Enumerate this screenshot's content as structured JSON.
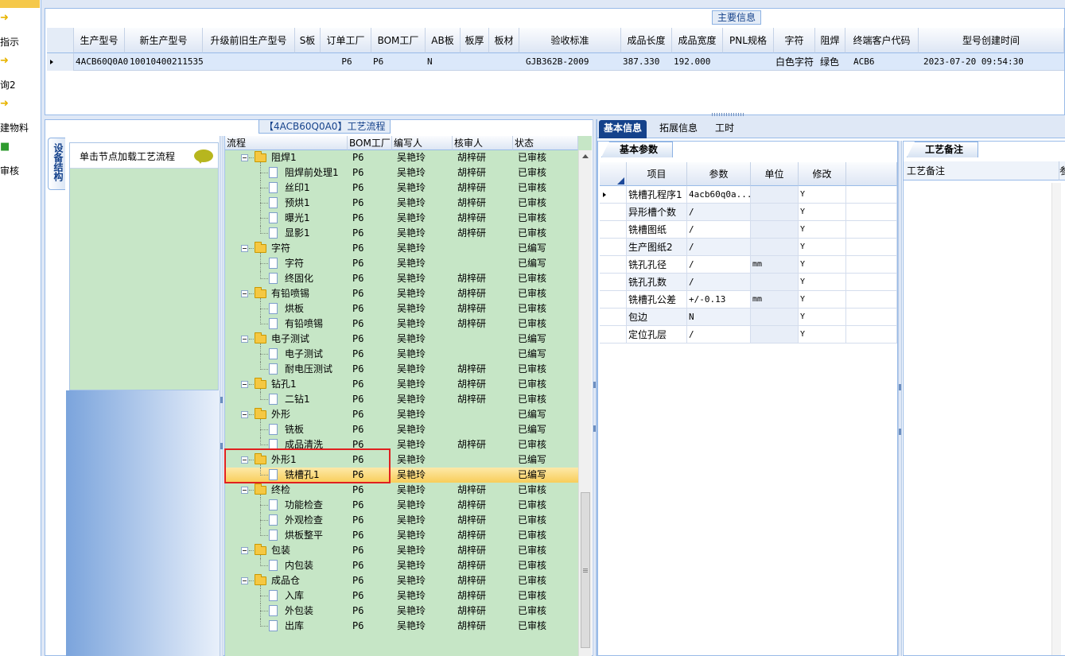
{
  "leftnav": {
    "items": [
      {
        "label": "指示",
        "icon": "folder-arrow-icon"
      },
      {
        "label": "询2",
        "icon": "folder-arrow-icon"
      },
      {
        "label": "建物料",
        "icon": "folder-arrow-icon"
      },
      {
        "label": "审核",
        "icon": "green-doc-icon"
      }
    ]
  },
  "main_info": {
    "title": "主要信息",
    "columns": [
      "生产型号",
      "新生产型号",
      "升级前旧生产型号",
      "S板",
      "订单工厂",
      "BOM工厂",
      "AB板",
      "板厚",
      "板材",
      "验收标准",
      "成品长度",
      "成品宽度",
      "PNL规格",
      "字符",
      "阻焊",
      "终端客户代码",
      "型号创建时间"
    ],
    "row": [
      "4ACB60Q0A0",
      "10010400211535",
      "",
      "",
      "P6",
      "P6",
      "N",
      "",
      "",
      "GJB362B-2009",
      "387.330",
      "192.000",
      "",
      "白色字符",
      "绿色",
      "ACB6",
      "2023-07-20 09:54:30"
    ]
  },
  "process": {
    "title": "【4ACB60Q0A0】工艺流程",
    "side_tab": "设备结构",
    "hint": "单击节点加载工艺流程",
    "columns": [
      "流程",
      "BOM工厂",
      "编写人",
      "核审人",
      "状态"
    ],
    "rows": [
      {
        "name": "阻焊1",
        "level": 0,
        "bom": "P6",
        "writer": "吴艳玲",
        "reviewer": "胡梓研",
        "status": "已审核"
      },
      {
        "name": "阻焊前处理1",
        "level": 1,
        "bom": "P6",
        "writer": "吴艳玲",
        "reviewer": "胡梓研",
        "status": "已审核"
      },
      {
        "name": "丝印1",
        "level": 1,
        "bom": "P6",
        "writer": "吴艳玲",
        "reviewer": "胡梓研",
        "status": "已审核"
      },
      {
        "name": "预烘1",
        "level": 1,
        "bom": "P6",
        "writer": "吴艳玲",
        "reviewer": "胡梓研",
        "status": "已审核"
      },
      {
        "name": "曝光1",
        "level": 1,
        "bom": "P6",
        "writer": "吴艳玲",
        "reviewer": "胡梓研",
        "status": "已审核"
      },
      {
        "name": "显影1",
        "level": 1,
        "bom": "P6",
        "writer": "吴艳玲",
        "reviewer": "胡梓研",
        "status": "已审核"
      },
      {
        "name": "字符",
        "level": 0,
        "bom": "P6",
        "writer": "吴艳玲",
        "reviewer": "",
        "status": "已编写"
      },
      {
        "name": "字符",
        "level": 1,
        "bom": "P6",
        "writer": "吴艳玲",
        "reviewer": "",
        "status": "已编写"
      },
      {
        "name": "终固化",
        "level": 1,
        "bom": "P6",
        "writer": "吴艳玲",
        "reviewer": "胡梓研",
        "status": "已审核"
      },
      {
        "name": "有铅喷锡",
        "level": 0,
        "bom": "P6",
        "writer": "吴艳玲",
        "reviewer": "胡梓研",
        "status": "已审核"
      },
      {
        "name": "烘板",
        "level": 1,
        "bom": "P6",
        "writer": "吴艳玲",
        "reviewer": "胡梓研",
        "status": "已审核"
      },
      {
        "name": "有铅喷锡",
        "level": 1,
        "bom": "P6",
        "writer": "吴艳玲",
        "reviewer": "胡梓研",
        "status": "已审核"
      },
      {
        "name": "电子测试",
        "level": 0,
        "bom": "P6",
        "writer": "吴艳玲",
        "reviewer": "",
        "status": "已编写"
      },
      {
        "name": "电子测试",
        "level": 1,
        "bom": "P6",
        "writer": "吴艳玲",
        "reviewer": "",
        "status": "已编写"
      },
      {
        "name": "耐电压测试",
        "level": 1,
        "bom": "P6",
        "writer": "吴艳玲",
        "reviewer": "胡梓研",
        "status": "已审核"
      },
      {
        "name": "钻孔1",
        "level": 0,
        "bom": "P6",
        "writer": "吴艳玲",
        "reviewer": "胡梓研",
        "status": "已审核"
      },
      {
        "name": "二钻1",
        "level": 1,
        "bom": "P6",
        "writer": "吴艳玲",
        "reviewer": "胡梓研",
        "status": "已审核"
      },
      {
        "name": "外形",
        "level": 0,
        "bom": "P6",
        "writer": "吴艳玲",
        "reviewer": "",
        "status": "已编写"
      },
      {
        "name": "铣板",
        "level": 1,
        "bom": "P6",
        "writer": "吴艳玲",
        "reviewer": "",
        "status": "已编写"
      },
      {
        "name": "成品清洗",
        "level": 1,
        "bom": "P6",
        "writer": "吴艳玲",
        "reviewer": "胡梓研",
        "status": "已审核"
      },
      {
        "name": "外形1",
        "level": 0,
        "bom": "P6",
        "writer": "吴艳玲",
        "reviewer": "",
        "status": "已编写"
      },
      {
        "name": "铣槽孔1",
        "level": 1,
        "bom": "P6",
        "writer": "吴艳玲",
        "reviewer": "",
        "status": "已编写",
        "selected": true
      },
      {
        "name": "终检",
        "level": 0,
        "bom": "P6",
        "writer": "吴艳玲",
        "reviewer": "胡梓研",
        "status": "已审核"
      },
      {
        "name": "功能检查",
        "level": 1,
        "bom": "P6",
        "writer": "吴艳玲",
        "reviewer": "胡梓研",
        "status": "已审核"
      },
      {
        "name": "外观检查",
        "level": 1,
        "bom": "P6",
        "writer": "吴艳玲",
        "reviewer": "胡梓研",
        "status": "已审核"
      },
      {
        "name": "烘板整平",
        "level": 1,
        "bom": "P6",
        "writer": "吴艳玲",
        "reviewer": "胡梓研",
        "status": "已审核"
      },
      {
        "name": "包装",
        "level": 0,
        "bom": "P6",
        "writer": "吴艳玲",
        "reviewer": "胡梓研",
        "status": "已审核"
      },
      {
        "name": "内包装",
        "level": 1,
        "bom": "P6",
        "writer": "吴艳玲",
        "reviewer": "胡梓研",
        "status": "已审核"
      },
      {
        "name": "成品仓",
        "level": 0,
        "bom": "P6",
        "writer": "吴艳玲",
        "reviewer": "胡梓研",
        "status": "已审核"
      },
      {
        "name": "入库",
        "level": 1,
        "bom": "P6",
        "writer": "吴艳玲",
        "reviewer": "胡梓研",
        "status": "已审核"
      },
      {
        "name": "外包装",
        "level": 1,
        "bom": "P6",
        "writer": "吴艳玲",
        "reviewer": "胡梓研",
        "status": "已审核"
      },
      {
        "name": "出库",
        "level": 1,
        "bom": "P6",
        "writer": "吴艳玲",
        "reviewer": "胡梓研",
        "status": "已审核"
      }
    ]
  },
  "right": {
    "tabs": [
      "基本信息",
      "拓展信息",
      "工时"
    ],
    "basic_title": "基本参数",
    "param_columns": [
      "项目",
      "参数",
      "单位",
      "修改"
    ],
    "params": [
      {
        "item": "铣槽孔程序1",
        "value": "4acb60q0a...",
        "unit": "",
        "edit": "Y"
      },
      {
        "item": "异形槽个数",
        "value": "/",
        "unit": "",
        "edit": "Y"
      },
      {
        "item": "铣槽图纸",
        "value": "/",
        "unit": "",
        "edit": "Y"
      },
      {
        "item": "生产图纸2",
        "value": "/",
        "unit": "",
        "edit": "Y"
      },
      {
        "item": "铣孔孔径",
        "value": "/",
        "unit": "mm",
        "edit": "Y"
      },
      {
        "item": "铣孔孔数",
        "value": "/",
        "unit": "",
        "edit": "Y"
      },
      {
        "item": "铣槽孔公差",
        "value": "+/-0.13",
        "unit": "mm",
        "edit": "Y"
      },
      {
        "item": "包边",
        "value": "N",
        "unit": "",
        "edit": "Y"
      },
      {
        "item": "定位孔层",
        "value": "/",
        "unit": "",
        "edit": "Y"
      }
    ],
    "remark_title": "工艺备注",
    "remark_column": "工艺备注",
    "remark_extra": "参"
  }
}
